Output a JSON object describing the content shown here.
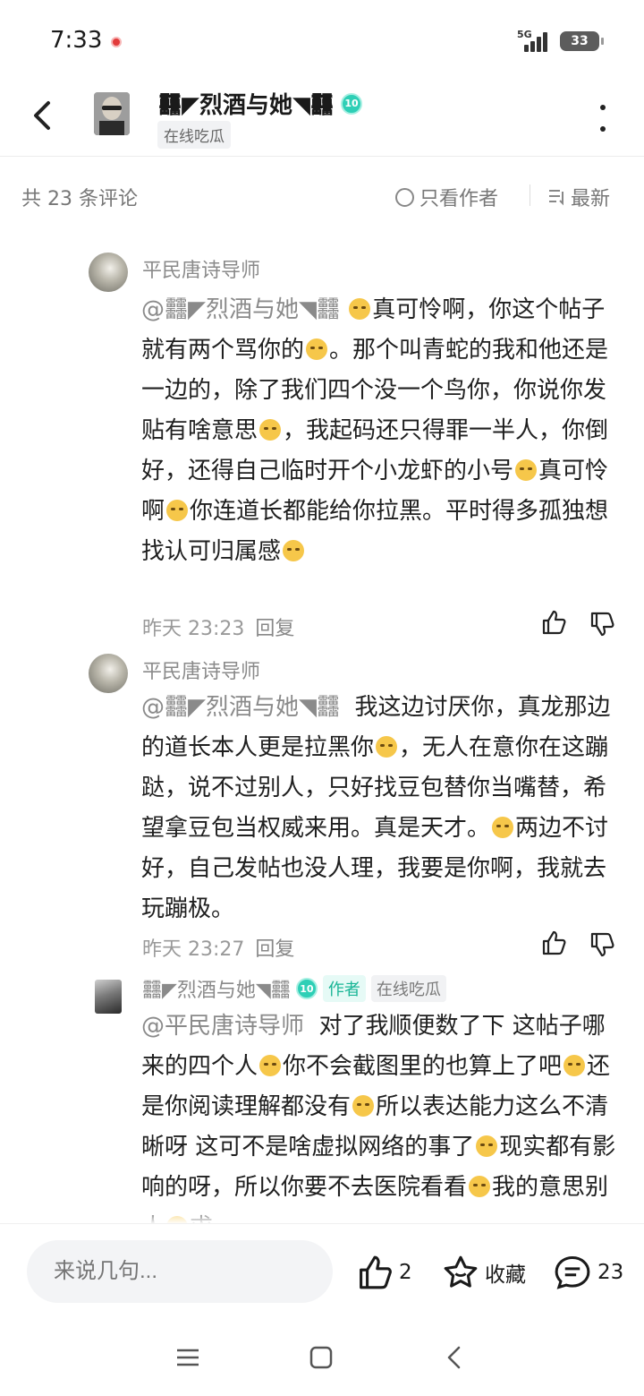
{
  "status": {
    "time": "7:33",
    "network": "5G",
    "battery": "33"
  },
  "header": {
    "name": "䨻◤烈酒与她◥䨻",
    "level": "10",
    "tag": "在线吃瓜"
  },
  "comments_bar": {
    "count_text": "共 23 条评论",
    "only_author": "只看作者",
    "sort": "最新"
  },
  "comments": [
    {
      "user": "平民唐诗导师",
      "mention": "@䨻◤烈酒与她◥䨻",
      "segments": [
        "真可怜啊，你这个帖子就有两个骂你的",
        "。那个叫青蛇的我和他还是一边的，除了我们四个没一个鸟你，你说你发贴有啥意思",
        "，我起码还只得罪一半人，你倒好，还得自己临时开个小龙虾的小号",
        "真可怜啊",
        "你连道长都能给你拉黑。平时得多孤独想找认可归属感"
      ],
      "time": "昨天 23:23",
      "reply": "回复"
    },
    {
      "user": "平民唐诗导师",
      "mention": "@䨻◤烈酒与她◥䨻",
      "segments": [
        "我这边讨厌你，真龙那边的道长本人更是拉黑你",
        "，无人在意你在这蹦跶，说不过别人，只好找豆包替你当嘴替，希望拿豆包当权威来用。真是天才。",
        "两边不讨好，自己发帖也没人理，我要是你啊，我就去玩蹦极。"
      ],
      "time": "昨天 23:27",
      "reply": "回复"
    },
    {
      "user": "䨻◤烈酒与她◥䨻",
      "level": "10",
      "tag_author": "作者",
      "tag": "在线吃瓜",
      "mention": "@平民唐诗导师",
      "segments": [
        "对了我顺便数了下  这帖子哪来的四个人",
        "你不会截图里的也算上了吧",
        "还是你阅读理解都没有",
        "所以表达能力这么不清晰呀  这可不是啥虚拟网络的事了",
        "现实都有影响的呀，所以你要不去医院看看",
        "我的意思别人",
        "求"
      ]
    }
  ],
  "bottom_bar": {
    "input_placeholder": "来说几句...",
    "like_count": "2",
    "collect_label": "收藏",
    "comment_count": "23"
  },
  "icons": {
    "back": "back-arrow-icon",
    "more": "more-vertical-icon",
    "like": "thumb-up-icon",
    "dislike": "thumb-down-icon",
    "collect": "star-icon",
    "comment": "comment-bubble-icon"
  }
}
